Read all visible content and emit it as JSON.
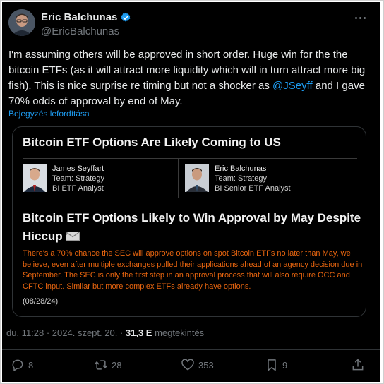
{
  "author": {
    "name": "Eric Balchunas",
    "handle": "@EricBalchunas",
    "verified": true
  },
  "tweet": {
    "text_before": "I'm assuming others will be approved in short order. Huge win for the the bitcoin ETFs (as it will attract more liquidity which will in turn attract more big fish). This is nice surprise re timing but not a shocker as ",
    "mention": "@JSeyff",
    "text_after": " and I gave 70% odds of approval by end of May.",
    "translate_label": "Bejegyzés lefordítása"
  },
  "card": {
    "headline": "Bitcoin ETF Options Are Likely Coming to US",
    "authors": [
      {
        "name": "James Seyffart",
        "team": "Team: Strategy",
        "role": "BI ETF Analyst"
      },
      {
        "name": "Eric Balchunas",
        "team": "Team: Strategy",
        "role": "BI Senior ETF Analyst"
      }
    ],
    "subhead": "Bitcoin ETF Options Likely to Win Approval by May Despite Hiccup",
    "body": "There's a 70% chance the SEC will approve options on spot Bitcoin ETFs no later than May, we believe, even after multiple exchanges pulled their applications ahead of an agency decision due in September. The SEC is only the first step in an approval process that will also require OCC and CFTC input. Similar but more complex ETFs already have options.",
    "date": "(08/28/24)"
  },
  "meta": {
    "timestamp": "du. 11:28 · 2024. szept. 20. · ",
    "views": "31,3 E",
    "views_label": " megtekintés"
  },
  "actions": {
    "replies": "8",
    "reposts": "28",
    "likes": "353",
    "bookmarks": "9"
  },
  "colors": {
    "accent": "#1d9bf0",
    "card_body": "#e8650f",
    "background": "#000000"
  }
}
